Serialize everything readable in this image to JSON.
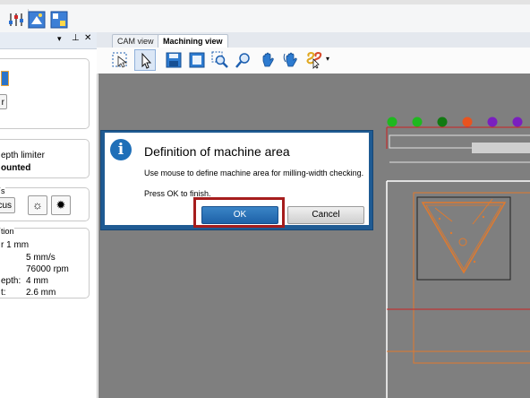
{
  "tabs": [
    {
      "label": "CAM view",
      "active": false
    },
    {
      "label": "Machining view",
      "active": true
    }
  ],
  "left_panel": {
    "header_icons": [
      "dropdown-icon",
      "pin-icon",
      "close-icon"
    ],
    "group1": {
      "button_partial": "r"
    },
    "group2": {
      "line1": "epth limiter",
      "line2": "ounted"
    },
    "group3": {
      "title_partial": "s",
      "button_partial": "cus"
    },
    "group4": {
      "title_partial": "tion",
      "rows": [
        {
          "label": "r 1 mm",
          "value": ""
        },
        {
          "label": "",
          "value": "5 mm/s"
        },
        {
          "label": "",
          "value": "76000 rpm"
        },
        {
          "label": "epth:",
          "value": "4 mm"
        },
        {
          "label": "t:",
          "value": "2.6 mm"
        }
      ]
    }
  },
  "view_toolbar_icons": [
    "select-region-icon",
    "pointer-icon",
    "save-view-icon",
    "fit-view-icon",
    "zoom-area-icon",
    "zoom-icon",
    "pan-hand-icon",
    "rotate-hand-icon",
    "snap-tool-icon"
  ],
  "dialog": {
    "title": "Definition of machine area",
    "message": "Use mouse to define machine area for milling-width checking.",
    "instruction": "Press OK to finish.",
    "ok_label": "OK",
    "cancel_label": "Cancel"
  },
  "canvas": {
    "indicator_colors": [
      "#1fb81f",
      "#1fb81f",
      "#127a12",
      "#e8531f",
      "#7a1fbf",
      "#7a1fbf"
    ],
    "background": "#7f7f7f",
    "accent_orange": "#e07a2e",
    "accent_red": "#cc2222"
  }
}
